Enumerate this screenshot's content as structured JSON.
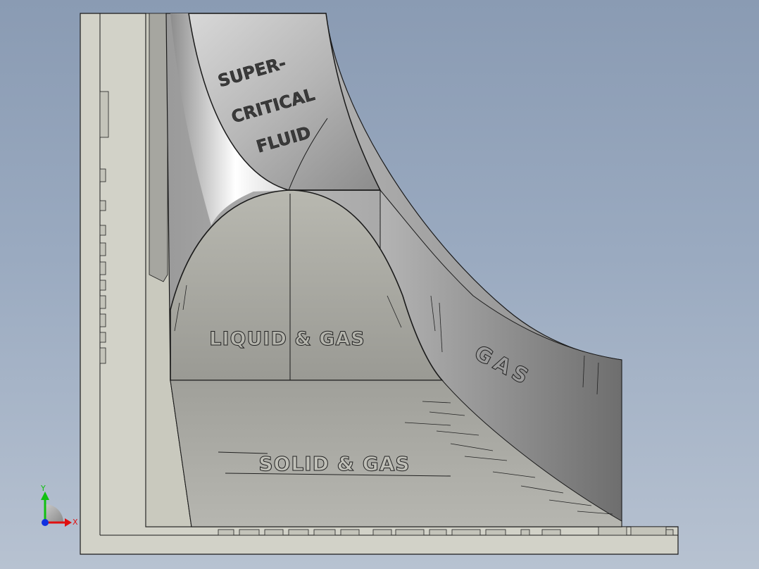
{
  "labels": {
    "supercritical_line1": "SUPER-",
    "supercritical_line2": "CRITICAL",
    "supercritical_line3": "FLUID",
    "liquid_gas": "LIQUID & GAS",
    "solid_gas": "SOLID & GAS",
    "gas": "GAS"
  },
  "triad": {
    "x_label": "X",
    "y_label": "Y"
  },
  "colors": {
    "background_top": "#8a9bb3",
    "background_bottom": "#b7c2d1",
    "base_plate": "#d2d2c8",
    "surface": "#a8a8a8",
    "edge": "#1a1a1a",
    "triad_x": "#e01010",
    "triad_y": "#10c010",
    "triad_origin": "#1030e0"
  },
  "icons": {
    "triad": "axis-triad-icon"
  }
}
